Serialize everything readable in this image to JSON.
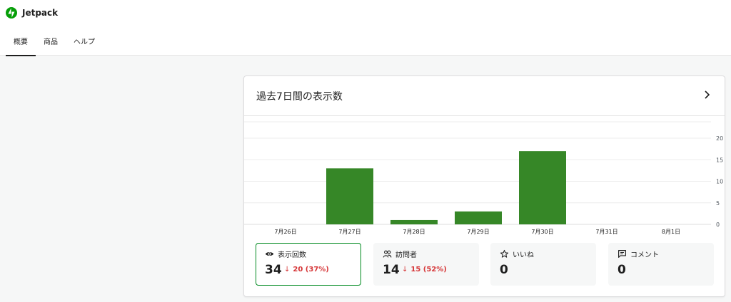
{
  "brand": {
    "name": "Jetpack",
    "color": "#069e08"
  },
  "tabs": [
    {
      "label": "概要",
      "active": true
    },
    {
      "label": "商品",
      "active": false
    },
    {
      "label": "ヘルプ",
      "active": false
    }
  ],
  "card": {
    "title": "過去7日間の表示数",
    "more_icon": "chevron-right-icon"
  },
  "chart_data": {
    "type": "bar",
    "categories": [
      "7月26日",
      "7月27日",
      "7月28日",
      "7月29日",
      "7月30日",
      "7月31日",
      "8月1日"
    ],
    "values": [
      0,
      13,
      1,
      3,
      17,
      0,
      0
    ],
    "ylim": [
      0,
      20
    ],
    "yticks": [
      0,
      5,
      10,
      15,
      20
    ],
    "color": "#368727",
    "grid": true,
    "axis_side": "right"
  },
  "stats": [
    {
      "icon": "eye-icon",
      "label": "表示回数",
      "value": "34",
      "delta_arrow": "↓",
      "delta": "20 (37%)",
      "active": true
    },
    {
      "icon": "people-icon",
      "label": "訪問者",
      "value": "14",
      "delta_arrow": "↓",
      "delta": "15 (52%)",
      "active": false
    },
    {
      "icon": "star-icon",
      "label": "いいね",
      "value": "0",
      "active": false
    },
    {
      "icon": "comment-icon",
      "label": "コメント",
      "value": "0",
      "active": false
    }
  ],
  "colors": {
    "accent": "#008a20",
    "negative": "#d63638"
  }
}
